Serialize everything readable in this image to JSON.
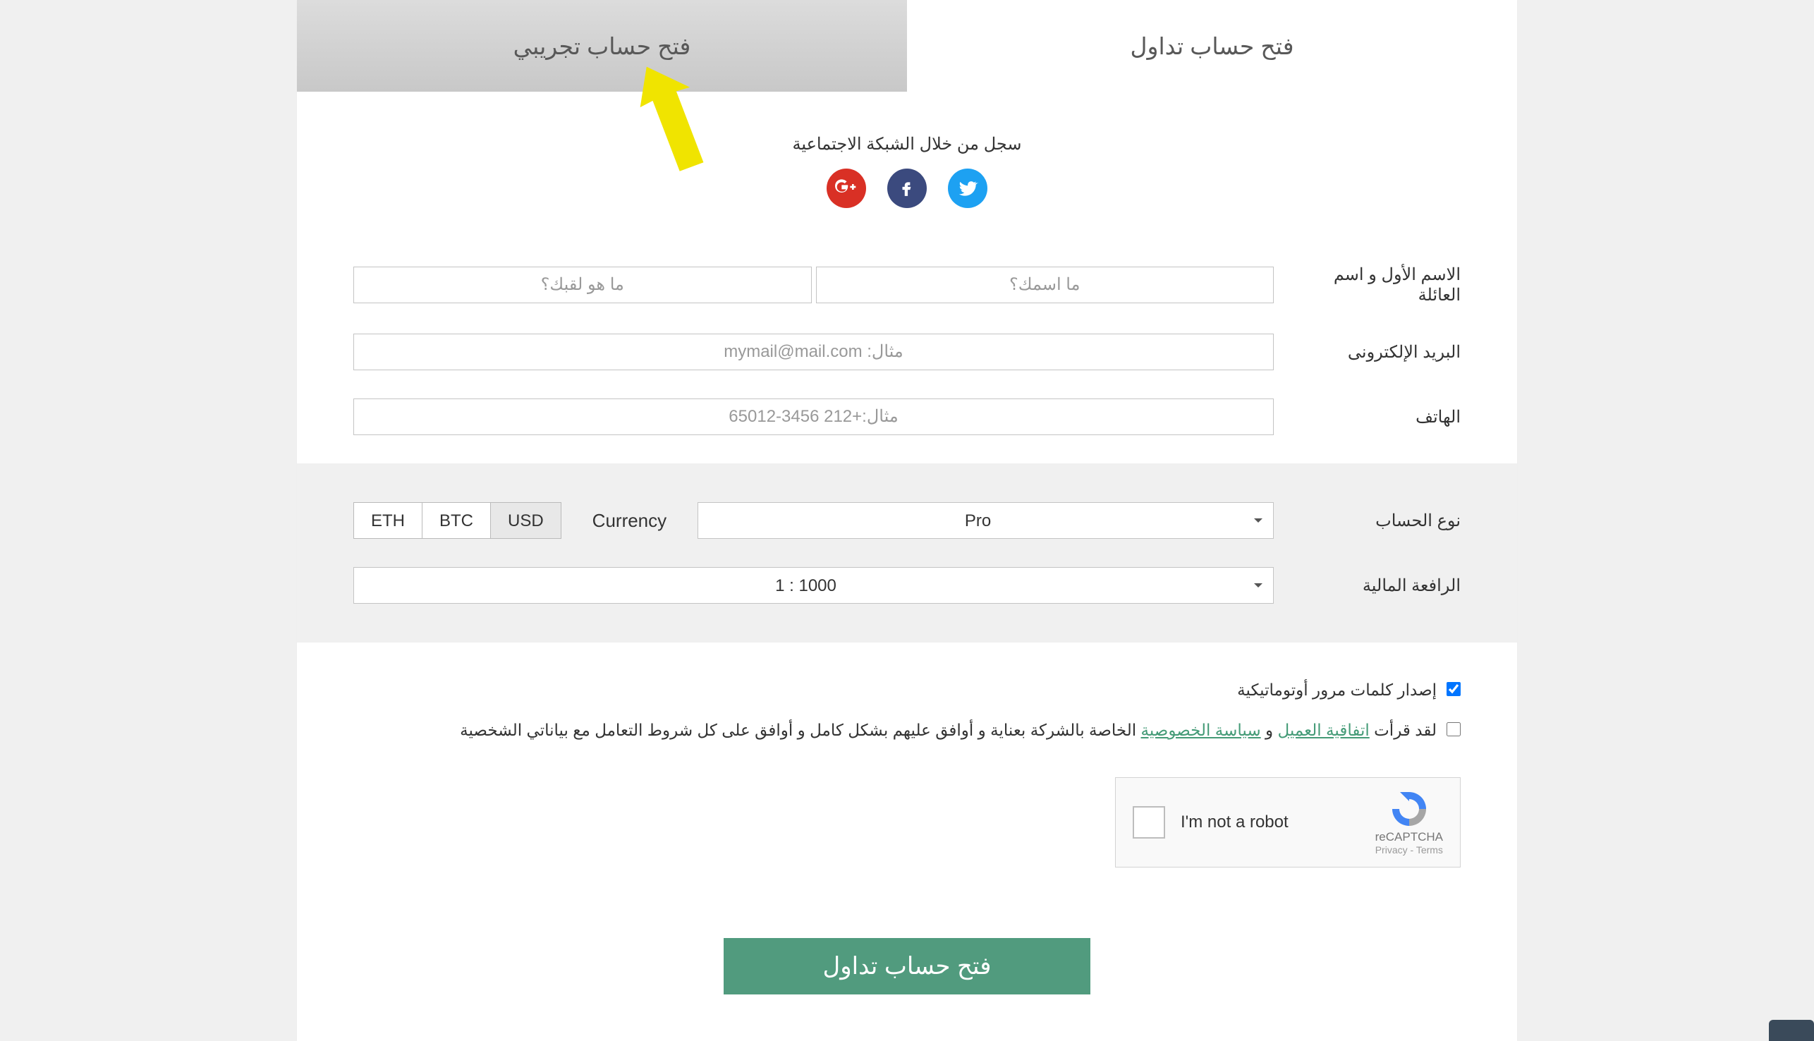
{
  "tabs": {
    "trading_label": "فتح حساب تداول",
    "demo_label": "فتح حساب تجريبي"
  },
  "social": {
    "heading": "سجل من خلال الشبكة الاجتماعية"
  },
  "labels": {
    "name": "الاسم الأول و اسم العائلة",
    "email": "البريد الإلكترونى",
    "phone": "الهاتف",
    "account_type": "نوع الحساب",
    "currency": "Currency",
    "leverage": "الرافعة المالية"
  },
  "placeholders": {
    "first_name": "ما اسمك؟",
    "last_name": "ما هو لقبك؟",
    "email": "مثال: mymail@mail.com",
    "phone": "مثال:+212 3456-65012"
  },
  "account": {
    "selected": "Pro",
    "currency_options": [
      "ETH",
      "BTC",
      "USD"
    ],
    "currency_selected": "USD",
    "leverage_selected": "1 : 1000"
  },
  "checkboxes": {
    "auto_password": "إصدار كلمات مرور أوتوماتيكية",
    "agreement_prefix": "لقد قرأت ",
    "agreement_link1": "اتفاقية العميل",
    "agreement_and": " و ",
    "agreement_link2": "سياسة الخصوصية",
    "agreement_suffix": " الخاصة بالشركة بعناية و أوافق عليهم بشكل كامل و أوافق على كل شروط التعامل مع بياناتي الشخصية"
  },
  "recaptcha": {
    "label": "I'm not a robot",
    "brand": "reCAPTCHA",
    "privacy": "Privacy",
    "terms": "Terms"
  },
  "submit": {
    "label": "فتح حساب تداول"
  }
}
